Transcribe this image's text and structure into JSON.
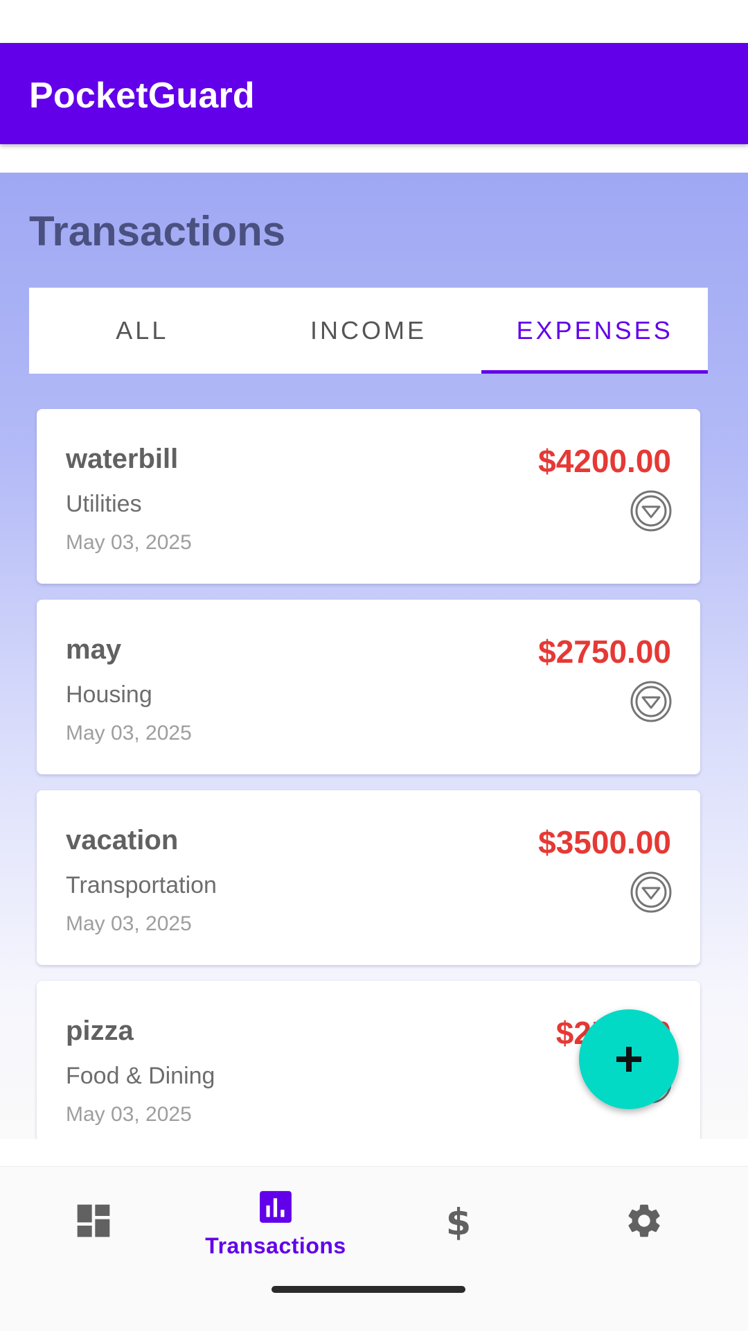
{
  "app": {
    "title": "PocketGuard"
  },
  "page": {
    "title": "Transactions"
  },
  "tabs": [
    {
      "label": "ALL",
      "active": false
    },
    {
      "label": "INCOME",
      "active": false
    },
    {
      "label": "EXPENSES",
      "active": true
    }
  ],
  "transactions": [
    {
      "title": "waterbill",
      "category": "Utilities",
      "date": "May 03, 2025",
      "amount": "$4200.00",
      "type_icon": "expense-down-icon"
    },
    {
      "title": "may",
      "category": "Housing",
      "date": "May 03, 2025",
      "amount": "$2750.00",
      "type_icon": "expense-down-icon"
    },
    {
      "title": "vacation",
      "category": "Transportation",
      "date": "May 03, 2025",
      "amount": "$3500.00",
      "type_icon": "expense-down-icon"
    },
    {
      "title": "pizza",
      "category": "Food & Dining",
      "date": "May 03, 2025",
      "amount": "$250.00",
      "type_icon": "expense-down-icon"
    }
  ],
  "fab": {
    "icon": "plus-icon"
  },
  "bottom_nav": {
    "items": [
      {
        "icon": "dashboard-icon",
        "label": "",
        "active": false
      },
      {
        "icon": "bar-chart-icon",
        "label": "Transactions",
        "active": true
      },
      {
        "icon": "dollar-icon",
        "label": "",
        "active": false
      },
      {
        "icon": "gear-icon",
        "label": "",
        "active": false
      }
    ]
  },
  "colors": {
    "primary": "#6200ea",
    "accent": "#03dac5",
    "expense": "#e53935",
    "icon_inactive": "#616161"
  }
}
